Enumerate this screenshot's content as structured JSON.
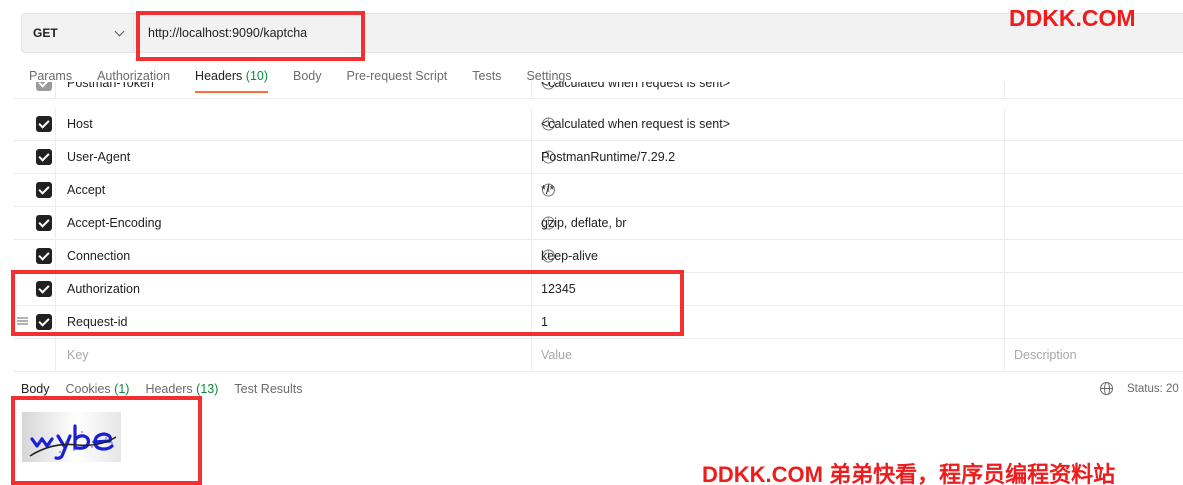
{
  "request": {
    "method": "GET",
    "url": "http://localhost:9090/kaptcha"
  },
  "tabs": [
    {
      "label": "Params"
    },
    {
      "label": "Authorization"
    },
    {
      "label": "Headers",
      "count": "(10)"
    },
    {
      "label": "Body"
    },
    {
      "label": "Pre-request Script"
    },
    {
      "label": "Tests"
    },
    {
      "label": "Settings"
    }
  ],
  "headers_table": {
    "rows": [
      {
        "key": "Postman-Token",
        "value": "<calculated when request is sent>",
        "checked": true
      },
      {
        "key": "Host",
        "value": "<calculated when request is sent>",
        "checked": true
      },
      {
        "key": "User-Agent",
        "value": "PostmanRuntime/7.29.2",
        "checked": true
      },
      {
        "key": "Accept",
        "value": "*/*",
        "checked": true
      },
      {
        "key": "Accept-Encoding",
        "value": "gzip, deflate, br",
        "checked": true
      },
      {
        "key": "Connection",
        "value": "keep-alive",
        "checked": true
      },
      {
        "key": "Authorization",
        "value": "12345",
        "checked": true
      },
      {
        "key": "Request-id",
        "value": "1",
        "checked": true
      }
    ],
    "new_row": {
      "key_placeholder": "Key",
      "value_placeholder": "Value",
      "description_placeholder": "Description"
    },
    "info_glyph": "i"
  },
  "response": {
    "tabs": [
      {
        "label": "Body"
      },
      {
        "label": "Cookies",
        "count": "(1)"
      },
      {
        "label": "Headers",
        "count": "(13)"
      },
      {
        "label": "Test Results"
      }
    ],
    "status_text": "Status: 20"
  },
  "watermarks": {
    "top": "DDKK.COM",
    "bottom": "DDKK.COM 弟弟快看，程序员编程资料站"
  },
  "colors": {
    "accent": "#ff6c37",
    "count_green": "#0e8a3c",
    "highlight_red": "#f23030",
    "watermark_red": "#ee1c1c"
  }
}
